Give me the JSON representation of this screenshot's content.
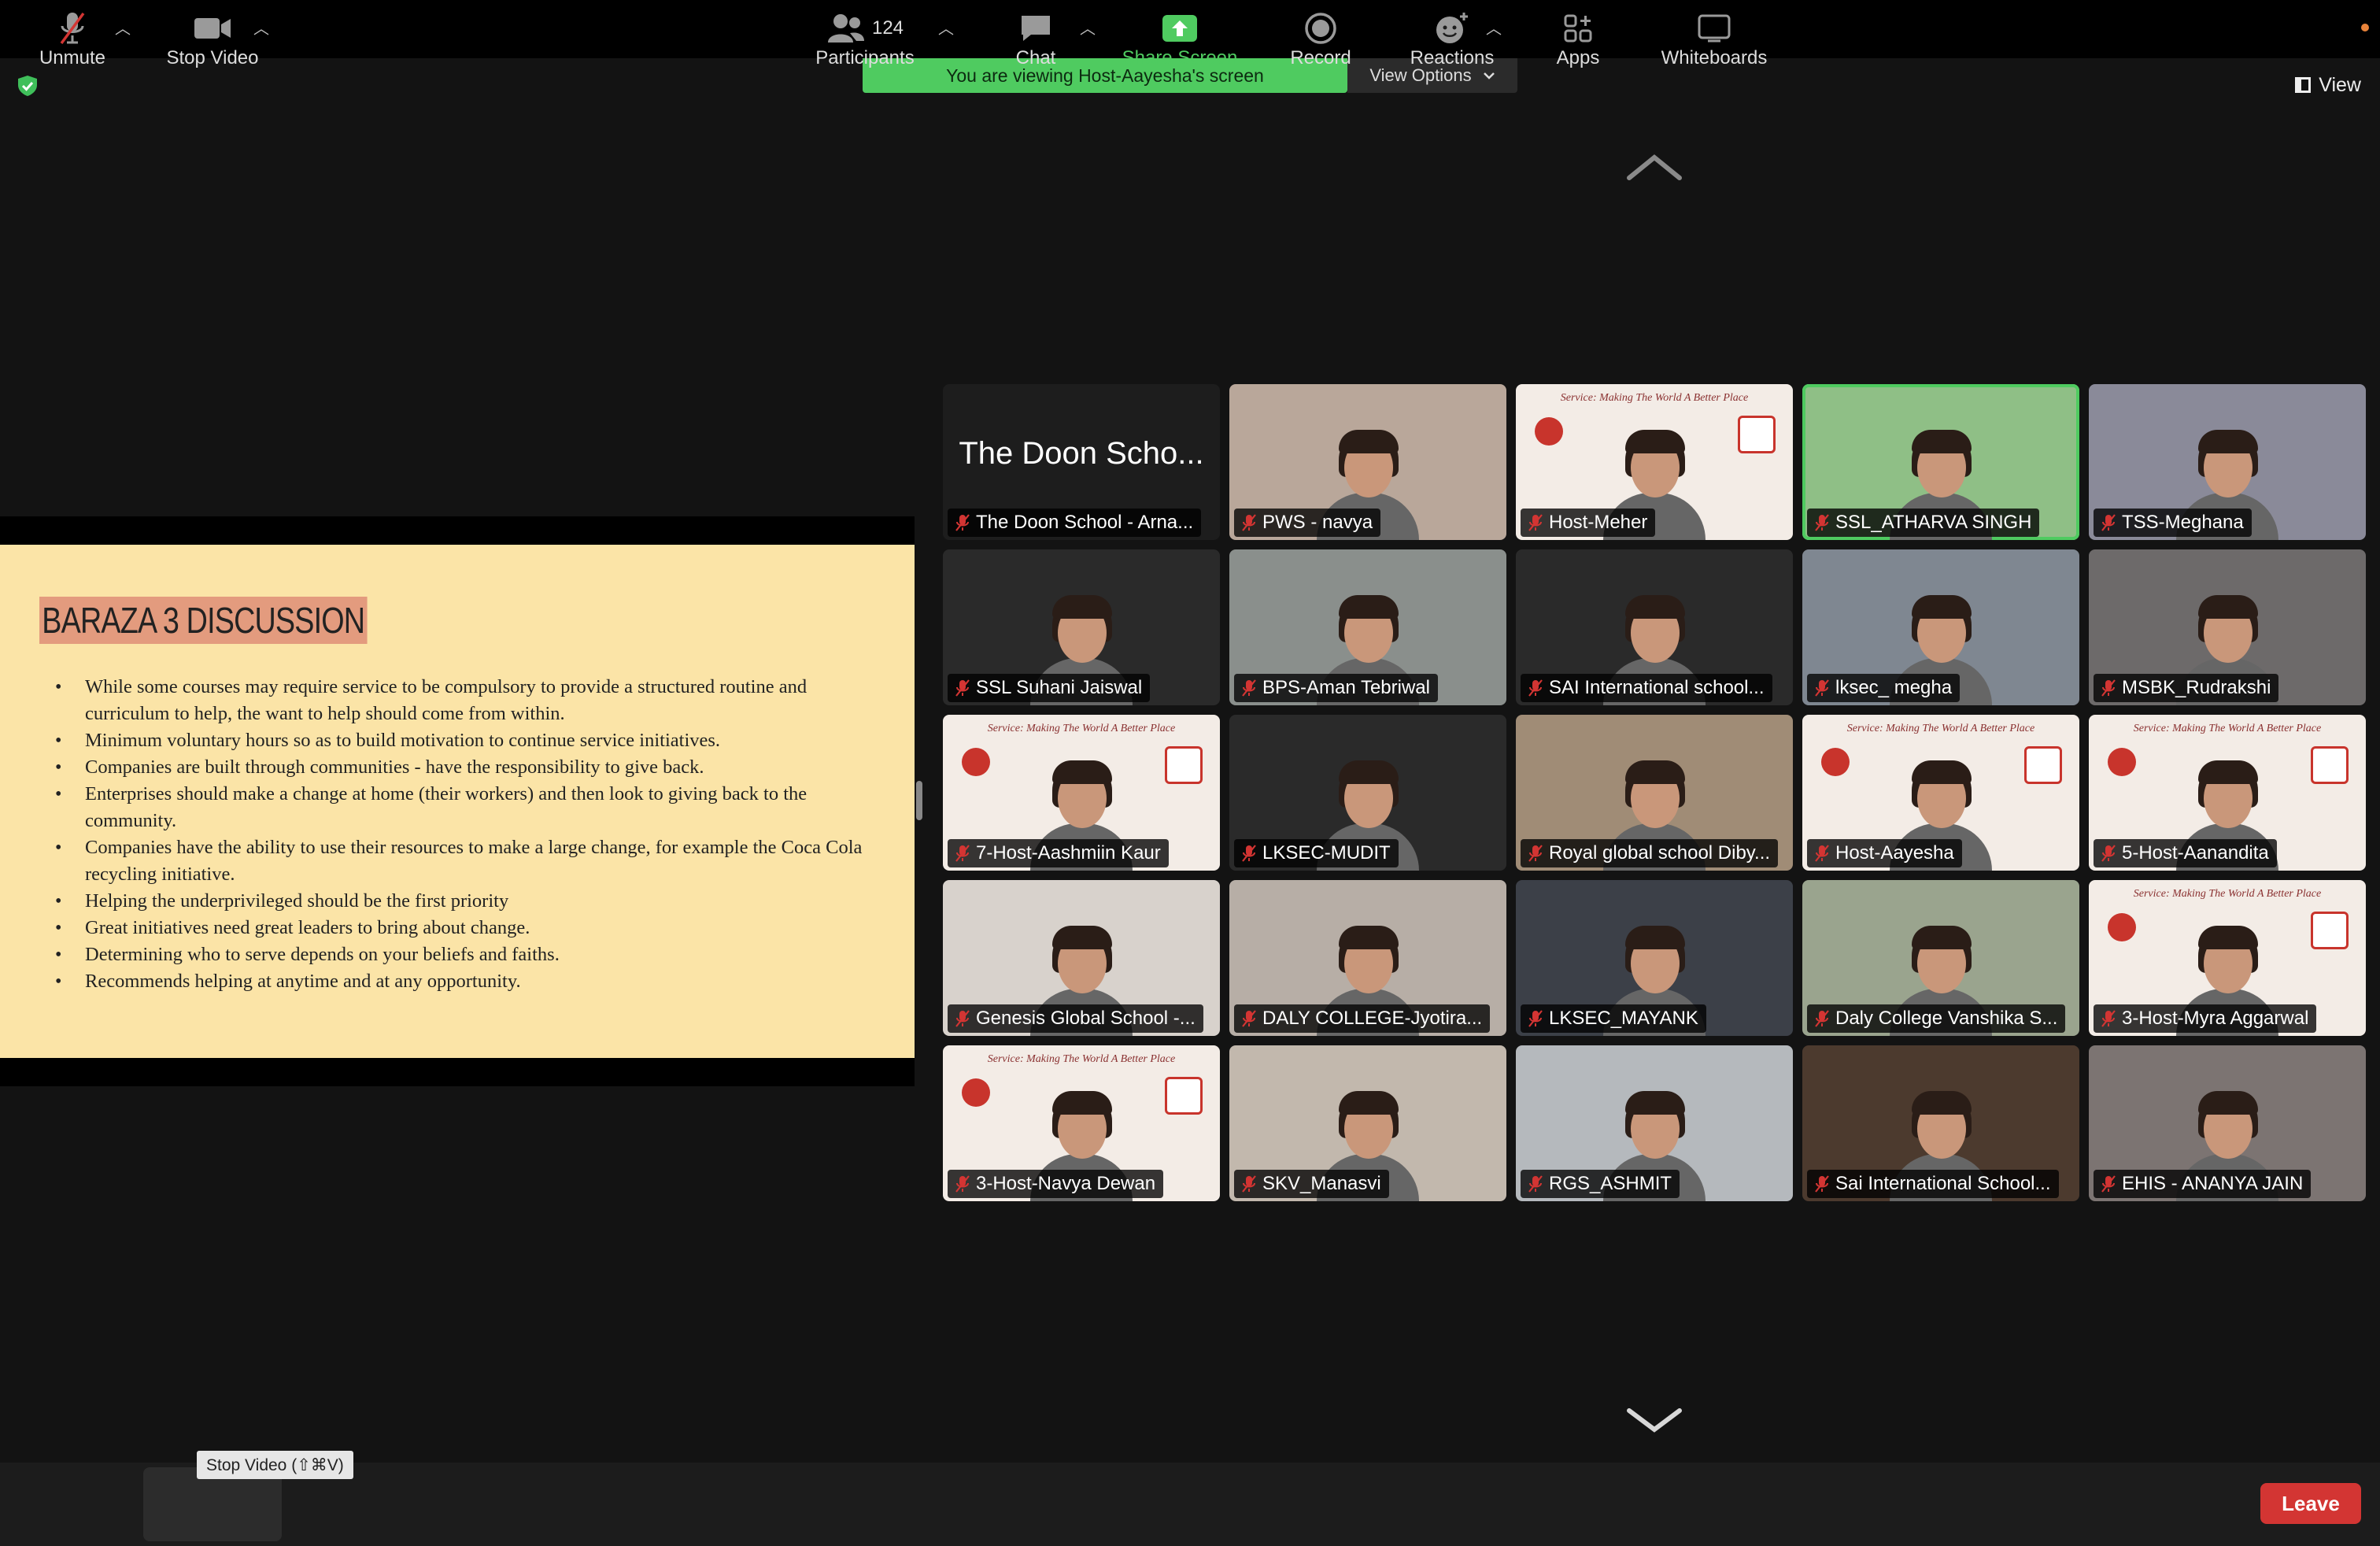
{
  "window": {
    "viewing_banner": "You are viewing Host-Aayesha's screen",
    "view_options_label": "View Options",
    "view_label": "View"
  },
  "slide": {
    "title": "BARAZA 3 DISCUSSION",
    "bullets": [
      "While some courses may require service to be compulsory to provide a structured routine and curriculum to help, the want to help should come from within.",
      "Minimum voluntary hours so as to build motivation to continue service initiatives.",
      "Companies are built through communities - have the responsibility to give back.",
      "Enterprises should make a change at home (their workers) and then look to giving back to the community.",
      "Companies have the ability to use their resources to make a large change, for example the Coca Cola recycling initiative.",
      "Helping the underprivileged should be the first priority",
      "Great initiatives need great leaders to bring about change.",
      "Determining who to serve depends on your beliefs and faiths.",
      "Recommends helping at anytime and at any opportunity."
    ]
  },
  "gallery": {
    "banner_text": "Service: Making The World A Better Place",
    "tiles": [
      {
        "name": "The Doon School - Arna...",
        "big_name": "The Doon Scho...",
        "bg": "#1d1d1d"
      },
      {
        "name": "PWS - navya",
        "bg": "#b9a79a"
      },
      {
        "name": "Host-Meher",
        "bg": "#f3ece6",
        "banner": true
      },
      {
        "name": "SSL_ATHARVA SINGH",
        "bg": "#8fbf86",
        "active": true
      },
      {
        "name": "TSS-Meghana",
        "bg": "#8a8a99"
      },
      {
        "name": "SSL Suhani Jaiswal",
        "bg": "#2a2a2a"
      },
      {
        "name": "BPS-Aman Tebriwal",
        "bg": "#8a8f8c"
      },
      {
        "name": "SAI International school...",
        "bg": "#2a2a2a"
      },
      {
        "name": "lksec_ megha",
        "bg": "#7f8791"
      },
      {
        "name": "MSBK_Rudrakshi",
        "bg": "#6d6a6a"
      },
      {
        "name": "7-Host-Aashmiin Kaur",
        "bg": "#f3ece6",
        "banner": true
      },
      {
        "name": "LKSEC-MUDIT",
        "bg": "#2a2a2a"
      },
      {
        "name": "Royal global school Diby...",
        "bg": "#a08c76"
      },
      {
        "name": "Host-Aayesha",
        "bg": "#f3ece6",
        "banner": true
      },
      {
        "name": "5-Host-Aanandita",
        "bg": "#f3ece6",
        "banner": true
      },
      {
        "name": "Genesis Global School -...",
        "bg": "#d8d2cc"
      },
      {
        "name": "DALY COLLEGE-Jyotira...",
        "bg": "#b7aea6"
      },
      {
        "name": "LKSEC_MAYANK",
        "bg": "#3c4048"
      },
      {
        "name": "Daly College Vanshika S...",
        "bg": "#9aa48e"
      },
      {
        "name": "3-Host-Myra Aggarwal",
        "bg": "#f3ece6",
        "banner": true
      },
      {
        "name": "3-Host-Navya Dewan",
        "bg": "#f3ece6",
        "banner": true
      },
      {
        "name": "SKV_Manasvi",
        "bg": "#c2b8ad"
      },
      {
        "name": "RGS_ASHMIT",
        "bg": "#b5b9bd"
      },
      {
        "name": "Sai International School...",
        "bg": "#4c3a2e"
      },
      {
        "name": "EHIS - ANANYA JAIN",
        "bg": "#7c7472"
      }
    ]
  },
  "toolbar": {
    "unmute": "Unmute",
    "stop_video": "Stop Video",
    "tooltip": "Stop Video (⇧⌘V)",
    "participants": "Participants",
    "participants_count": "124",
    "chat": "Chat",
    "share_screen": "Share Screen",
    "record": "Record",
    "reactions": "Reactions",
    "apps": "Apps",
    "whiteboards": "Whiteboards",
    "leave": "Leave"
  }
}
